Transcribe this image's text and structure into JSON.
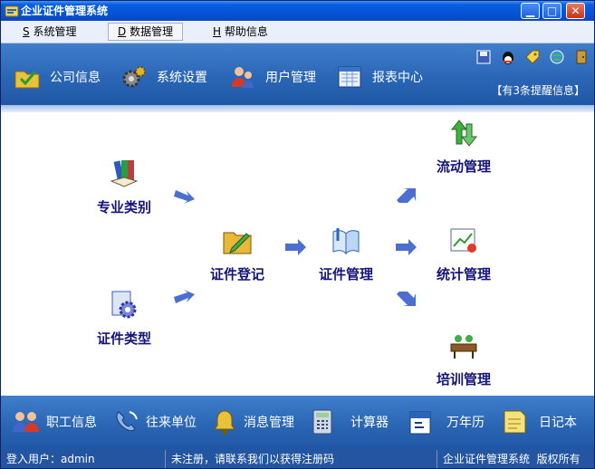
{
  "window": {
    "title": "企业证件管理系统",
    "controls": {
      "minimize": "▁",
      "maximize": "□",
      "close": "✕"
    }
  },
  "menu": [
    {
      "key": "S",
      "label": "系统管理"
    },
    {
      "key": "D",
      "label": "数据管理",
      "active": true
    },
    {
      "key": "H",
      "label": "帮助信息"
    }
  ],
  "toolbar": {
    "buttons": [
      {
        "label": "公司信息",
        "icon": "folder-check-icon"
      },
      {
        "label": "系统设置",
        "icon": "gears-icon"
      },
      {
        "label": "用户管理",
        "icon": "users-icon"
      },
      {
        "label": "报表中心",
        "icon": "report-icon"
      }
    ],
    "mini_icons": [
      "save-icon",
      "qq-penguin-icon",
      "tag-icon",
      "globe-icon",
      "exit-door-icon"
    ],
    "reminder": "【有3条提醒信息】"
  },
  "flow": {
    "nodes": {
      "major_category": "专业类别",
      "cert_type": "证件类型",
      "cert_register": "证件登记",
      "cert_manage": "证件管理",
      "flow_manage": "流动管理",
      "stats_manage": "统计管理",
      "training_manage": "培训管理"
    }
  },
  "bottom": {
    "buttons": [
      {
        "label": "职工信息",
        "icon": "staff-icon"
      },
      {
        "label": "往来单位",
        "icon": "phone-icon"
      },
      {
        "label": "消息管理",
        "icon": "bell-icon"
      },
      {
        "label": "计算器",
        "icon": "calculator-icon"
      },
      {
        "label": "万年历",
        "icon": "calendar-icon"
      },
      {
        "label": "日记本",
        "icon": "note-icon"
      }
    ]
  },
  "status": {
    "user": "登入用户：admin",
    "register": "未注册，请联系我们以获得注册码",
    "copyright": "企业证件管理系统  版权所有"
  },
  "colors": {
    "title_bar": "#0553d8",
    "toolbar": "#2b66b6",
    "flow_label": "#14147a",
    "flow_arrow": "#4a6fd1"
  }
}
